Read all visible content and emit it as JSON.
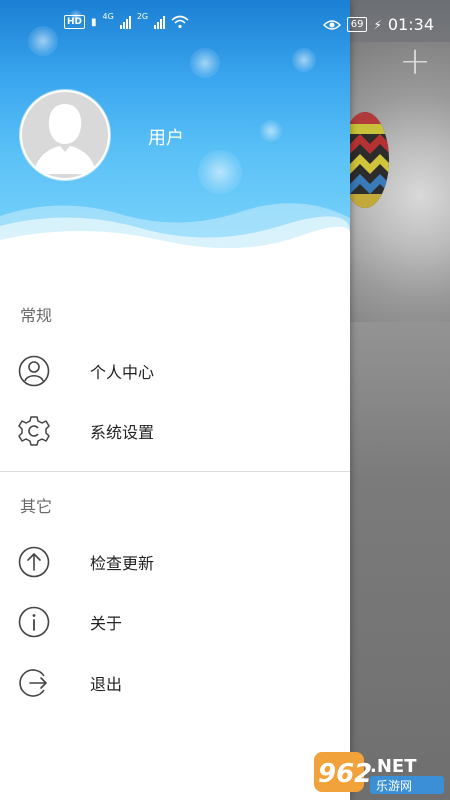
{
  "status_bar": {
    "hd": "HD",
    "net1": "4G",
    "net2": "2G",
    "battery": "69",
    "time": "01:34"
  },
  "header": {
    "username": "用户"
  },
  "sections": [
    {
      "title": "常规",
      "items": [
        {
          "label": "个人中心",
          "icon": "person-icon"
        },
        {
          "label": "系统设置",
          "icon": "gear-icon"
        }
      ]
    },
    {
      "title": "其它",
      "items": [
        {
          "label": "检查更新",
          "icon": "upload-arrow-icon"
        },
        {
          "label": "关于",
          "icon": "info-icon"
        },
        {
          "label": "退出",
          "icon": "logout-icon"
        }
      ]
    }
  ],
  "background": {
    "add_label": "+"
  },
  "watermark": {
    "brand": "962",
    "net": "NET",
    "tagline": "乐游网"
  },
  "colors": {
    "header_top": "#1b7fd3",
    "header_bottom": "#7fd6fb",
    "icon_stroke": "#444444"
  }
}
